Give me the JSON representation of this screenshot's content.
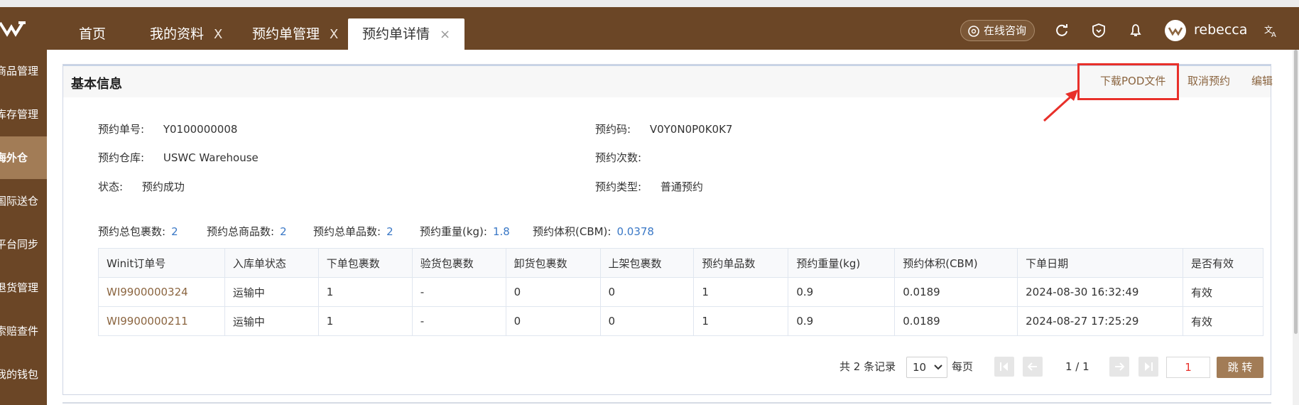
{
  "tabs": [
    {
      "label": "首页",
      "closable": false,
      "active": false
    },
    {
      "label": "我的资料",
      "closable": true,
      "active": false
    },
    {
      "label": "预约单管理",
      "closable": true,
      "active": false
    },
    {
      "label": "预约单详情",
      "closable": true,
      "active": true
    }
  ],
  "close_glyph": "X",
  "close_glyph_active": "×",
  "header": {
    "consult_label": "在线咨询",
    "username": "rebecca",
    "icons": [
      "refresh-icon",
      "heart-shield-icon",
      "bell-icon",
      "translate-icon"
    ]
  },
  "sidebar": {
    "items": [
      {
        "label": "商品管理",
        "active": false
      },
      {
        "label": "库存管理",
        "active": false
      },
      {
        "label": "海外仓",
        "active": true
      },
      {
        "label": "国际送仓",
        "active": false
      },
      {
        "label": "平台同步",
        "active": false
      },
      {
        "label": "退货管理",
        "active": false
      },
      {
        "label": "索赔查件",
        "active": false
      },
      {
        "label": "我的钱包",
        "active": false
      }
    ]
  },
  "card": {
    "title": "基本信息",
    "actions": {
      "download_pod": "下载POD文件",
      "cancel": "取消预约",
      "edit": "编辑"
    }
  },
  "info": {
    "order_no_label": "预约单号:",
    "order_no": "Y0100000008",
    "code_label": "预约码:",
    "code": "V0Y0N0P0K0K7",
    "warehouse_label": "预约仓库:",
    "warehouse": "USWC Warehouse",
    "times_label": "预约次数:",
    "times": "",
    "status_label": "状态:",
    "status": "预约成功",
    "type_label": "预约类型:",
    "type": "普通预约"
  },
  "summary": {
    "total_packages_label": "预约总包裹数:",
    "total_packages": "2",
    "total_goods_label": "预约总商品数:",
    "total_goods": "2",
    "total_single_label": "预约总单品数:",
    "total_single": "2",
    "weight_label": "预约重量(kg):",
    "weight": "1.8",
    "volume_label": "预约体积(CBM):",
    "volume": "0.0378"
  },
  "table": {
    "columns": [
      "Winit订单号",
      "入库单状态",
      "下单包裹数",
      "验货包裹数",
      "卸货包裹数",
      "上架包裹数",
      "预约单品数",
      "预约重量(kg)",
      "预约体积(CBM)",
      "下单日期",
      "是否有效"
    ],
    "rows": [
      [
        "WI9900000324",
        "运输中",
        "1",
        "-",
        "0",
        "0",
        "1",
        "0.9",
        "0.0189",
        "2024-08-30 16:32:49",
        "有效"
      ],
      [
        "WI9900000211",
        "运输中",
        "1",
        "-",
        "0",
        "0",
        "1",
        "0.9",
        "0.0189",
        "2024-08-27 17:25:29",
        "有效"
      ]
    ]
  },
  "pager": {
    "total_text": "共 2 条记录",
    "page_size": "10",
    "per_page_label": "每页",
    "page_info": "1 / 1",
    "page_input": "1",
    "jump_label": "跳 转"
  },
  "colors": {
    "brand": "#6b4626",
    "accent": "#a27c56",
    "link": "#8b6540",
    "value_blue": "#3a78c6",
    "highlight_red": "#e8302a"
  }
}
